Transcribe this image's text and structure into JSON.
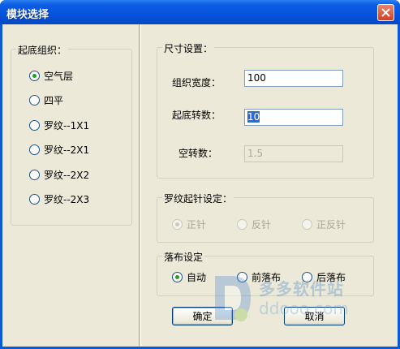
{
  "window": {
    "title": "模块选择"
  },
  "bottom_group": {
    "title": "起底组织：",
    "options": [
      {
        "label": "空气层",
        "checked": true
      },
      {
        "label": "四平",
        "checked": false
      },
      {
        "label": "罗纹--1X1",
        "checked": false
      },
      {
        "label": "罗纹--2X1",
        "checked": false
      },
      {
        "label": "罗纹--2X2",
        "checked": false
      },
      {
        "label": "罗纹--2X3",
        "checked": false
      }
    ]
  },
  "size_group": {
    "title": "尺寸设置：",
    "width_label": "组织宽度：",
    "width_value": "100",
    "turns_label": "起底转数：",
    "turns_value": "10",
    "empty_label": "空转数：",
    "empty_value": "1.5"
  },
  "rib_group": {
    "title": "罗纹起针设定：",
    "options": [
      {
        "label": "正针",
        "checked": true
      },
      {
        "label": "反针",
        "checked": false
      },
      {
        "label": "正反针",
        "checked": false
      }
    ]
  },
  "drop_group": {
    "title": "落布设定",
    "options": [
      {
        "label": "自动",
        "checked": true
      },
      {
        "label": "前落布",
        "checked": false
      },
      {
        "label": "后落布",
        "checked": false
      }
    ]
  },
  "buttons": {
    "ok": "确定",
    "cancel": "取消"
  },
  "watermark": {
    "line1": "多多软件站",
    "line2": "ddooo.com"
  },
  "colors": {
    "titlebar": "#0451d8",
    "dialog_bg": "#ece9d8",
    "selection": "#316ac5"
  }
}
